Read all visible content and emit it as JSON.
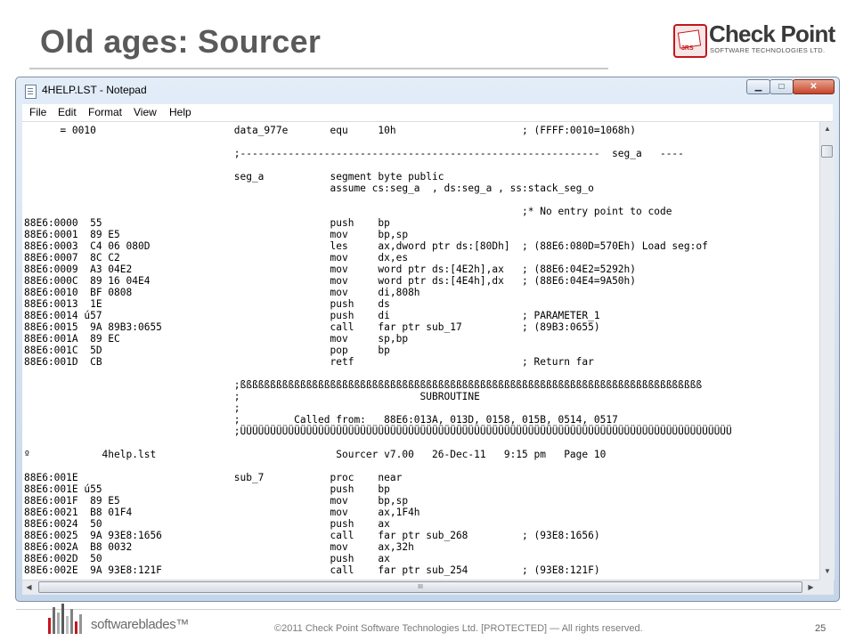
{
  "slide": {
    "title": "Old ages: Sourcer",
    "logo_name": "Check Point",
    "logo_sub": "SOFTWARE TECHNOLOGIES LTD.",
    "logo_emblem_text": "3RS",
    "footer_brand": "softwareblades™",
    "copyright": "©2011 Check Point Software Technologies Ltd.   [PROTECTED] — All rights reserved.",
    "page_number": "25",
    "colors": {
      "title": "#5a5a5a",
      "brand_red": "#c4161c"
    }
  },
  "window": {
    "title": "4HELP.LST - Notepad",
    "icon": "notepad-icon",
    "controls": {
      "minimize": "▁",
      "maximize": "□",
      "close": "✕"
    }
  },
  "menu": [
    "File",
    "Edit",
    "Format",
    "View",
    "Help"
  ],
  "editor": {
    "lines": [
      "      = 0010                       data_977e       equ     10h                     ; (FFFF:0010=1068h)",
      "",
      "                                   ;------------------------------------------------------------  seg_a   ----",
      "",
      "                                   seg_a           segment byte public",
      "                                                   assume cs:seg_a  , ds:seg_a , ss:stack_seg_o",
      "",
      "                                                                                   ;* No entry point to code",
      "88E6:0000  55                                      push    bp",
      "88E6:0001  89 E5                                   mov     bp,sp",
      "88E6:0003  C4 06 080D                              les     ax,dword ptr ds:[80Dh]  ; (88E6:080D=570Eh) Load seg:of",
      "88E6:0007  8C C2                                   mov     dx,es",
      "88E6:0009  A3 04E2                                 mov     word ptr ds:[4E2h],ax   ; (88E6:04E2=5292h)",
      "88E6:000C  89 16 04E4                              mov     word ptr ds:[4E4h],dx   ; (88E6:04E4=9A50h)",
      "88E6:0010  BF 0808                                 mov     di,808h",
      "88E6:0013  1E                                      push    ds",
      "88E6:0014 ú57                                      push    di                      ; PARAMETER_1",
      "88E6:0015  9A 89B3:0655                            call    far ptr sub_17          ; (89B3:0655)",
      "88E6:001A  89 EC                                   mov     sp,bp",
      "88E6:001C  5D                                      pop     bp",
      "88E6:001D  CB                                      retf                            ; Return far",
      "",
      "                                   ;ßßßßßßßßßßßßßßßßßßßßßßßßßßßßßßßßßßßßßßßßßßßßßßßßßßßßßßßßßßßßßßßßßßßßßßßßßßßßß",
      "                                   ;                              SUBROUTINE",
      "                                   ;",
      "                                   ;         Called from:   88E6:013A, 013D, 0158, 015B, 0514, 0517",
      "                                   ;ÜÜÜÜÜÜÜÜÜÜÜÜÜÜÜÜÜÜÜÜÜÜÜÜÜÜÜÜÜÜÜÜÜÜÜÜÜÜÜÜÜÜÜÜÜÜÜÜÜÜÜÜÜÜÜÜÜÜÜÜÜÜÜÜÜÜÜÜÜÜÜÜÜÜÜÜÜÜÜÜÜÜ",
      "",
      "º            4help.lst                              Sourcer v7.00   26-Dec-11   9:15 pm   Page 10",
      "",
      "88E6:001E                          sub_7           proc    near",
      "88E6:001E ú55                                      push    bp",
      "88E6:001F  89 E5                                   mov     bp,sp",
      "88E6:0021  B8 01F4                                 mov     ax,1F4h",
      "88E6:0024  50                                      push    ax",
      "88E6:0025  9A 93E8:1656                            call    far ptr sub_268         ; (93E8:1656)",
      "88E6:002A  B8 0032                                 mov     ax,32h",
      "88E6:002D  50                                      push    ax",
      "88E6:002E  9A 93E8:121F                            call    far ptr sub_254         ; (93E8:121F)"
    ]
  },
  "scrollbars": {
    "v_arrow_up": "▲",
    "v_arrow_down": "▼",
    "h_arrow_left": "◀",
    "h_arrow_right": "▶",
    "h_grip": "III"
  }
}
